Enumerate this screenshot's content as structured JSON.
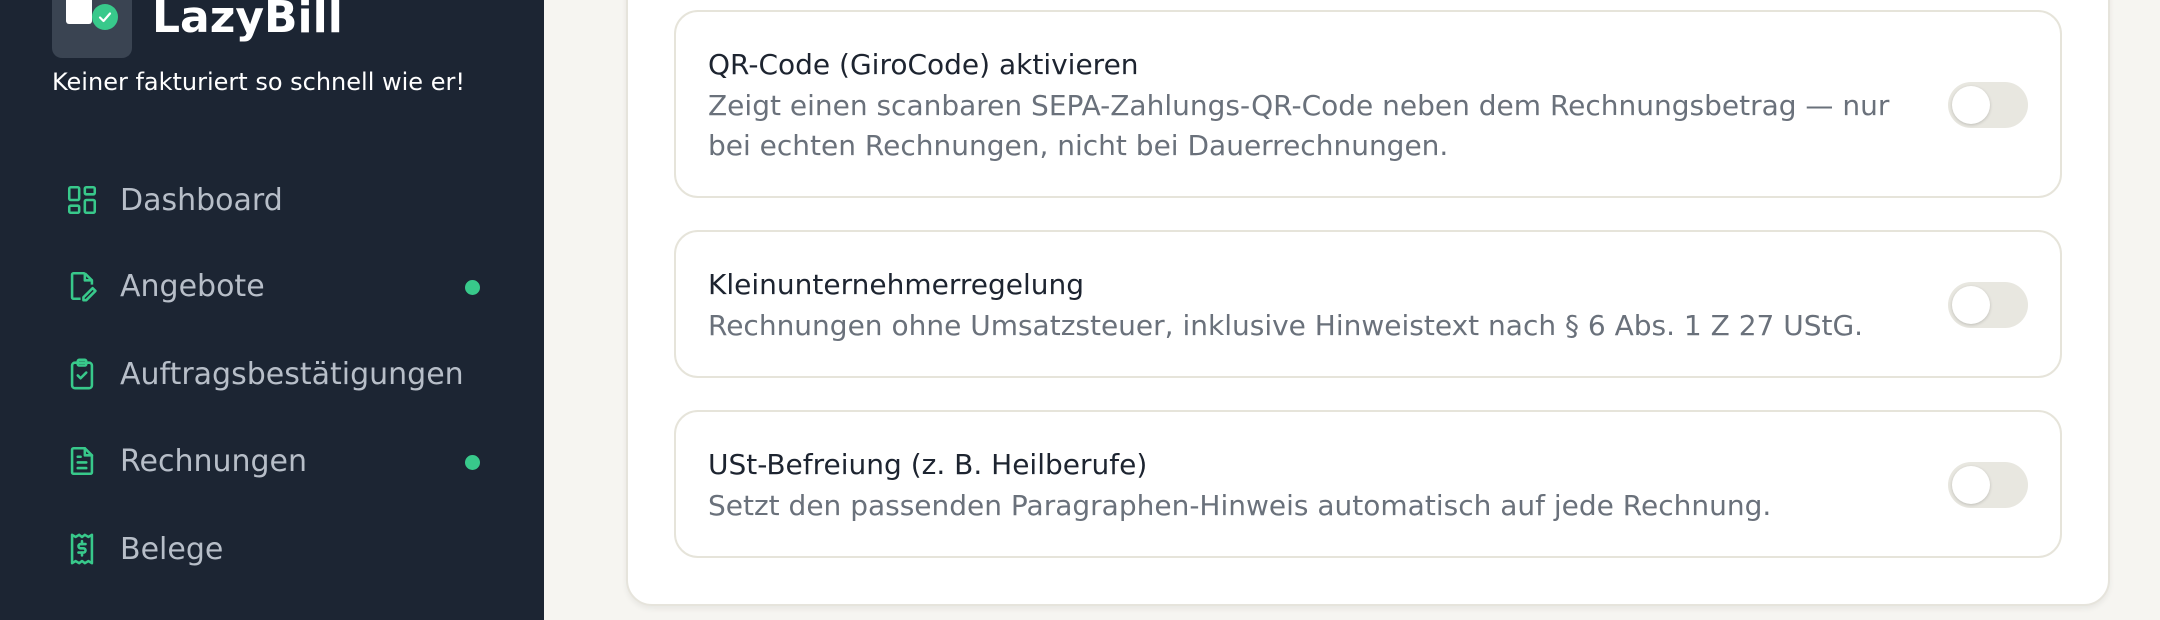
{
  "brand": {
    "title": "LazyBill",
    "tagline": "Keiner fakturiert so schnell wie er!"
  },
  "sidebar": {
    "items": [
      {
        "label": "Dashboard",
        "icon": "dashboard-icon",
        "dot": false
      },
      {
        "label": "Angebote",
        "icon": "document-edit-icon",
        "dot": true
      },
      {
        "label": "Auftragsbestätigungen",
        "icon": "clipboard-check-icon",
        "dot": false
      },
      {
        "label": "Rechnungen",
        "icon": "document-text-icon",
        "dot": true
      },
      {
        "label": "Belege",
        "icon": "receipt-icon",
        "dot": false
      }
    ]
  },
  "settings": [
    {
      "title": "QR-Code (GiroCode) aktivieren",
      "description": "Zeigt einen scanbaren SEPA-Zahlungs-QR-Code neben dem Rechnungsbetrag — nur bei echten Rechnungen, nicht bei Dauerrechnungen.",
      "enabled": false
    },
    {
      "title": "Kleinunternehmerregelung",
      "description": "Rechnungen ohne Umsatzsteuer, inklusive Hinweistext nach § 6 Abs. 1 Z 27 UStG.",
      "enabled": false
    },
    {
      "title": "USt-Befreiung (z. B. Heilberufe)",
      "description": "Setzt den passenden Paragraphen-Hinweis automatisch auf jede Rechnung.",
      "enabled": false
    }
  ],
  "colors": {
    "sidebar_bg": "#1c2533",
    "accent": "#38c98b",
    "page_bg": "#f6f5f1"
  }
}
